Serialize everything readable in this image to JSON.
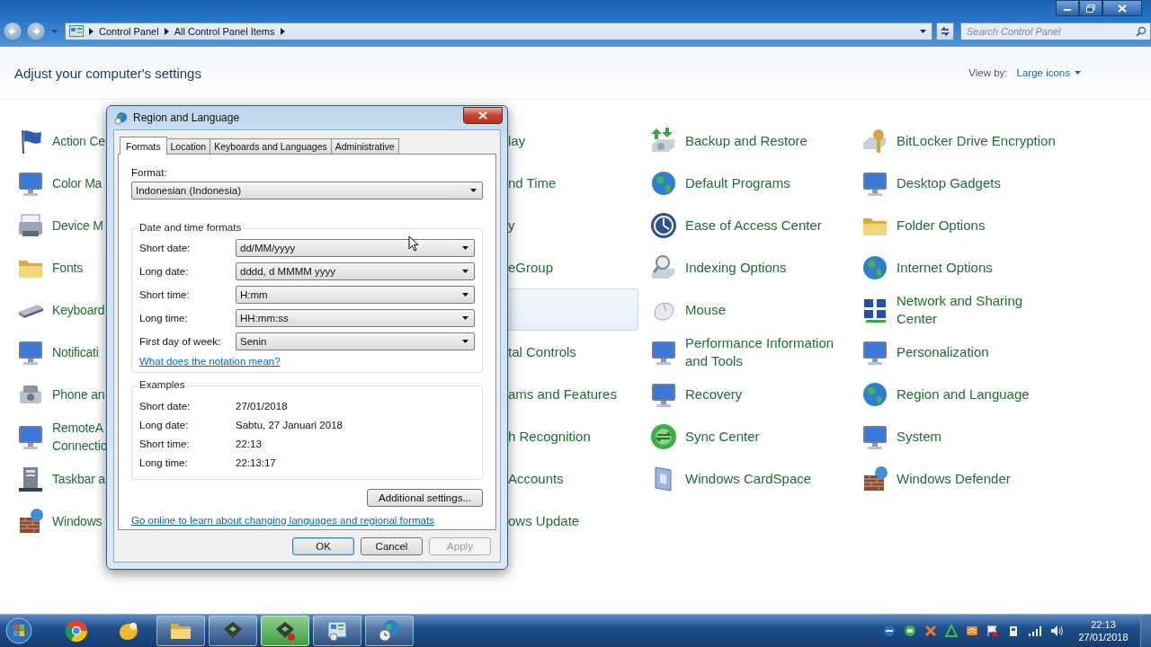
{
  "explorer": {
    "address_path": [
      "Control Panel",
      "All Control Panel Items"
    ],
    "search": {
      "placeholder": "Search Control Panel"
    }
  },
  "header": {
    "title": "Adjust your computer's settings",
    "view_by_label": "View by:",
    "view_by_value": "Large icons"
  },
  "columns": [
    [
      {
        "label": "Action Ce",
        "highlighted": false
      },
      {
        "label": "Color Ma",
        "highlighted": false
      },
      {
        "label": "Device M",
        "highlighted": false
      },
      {
        "label": "Fonts",
        "highlighted": false
      },
      {
        "label": "Keyboard",
        "highlighted": false
      },
      {
        "label": "Notificati",
        "highlighted": false
      },
      {
        "label": "Phone an",
        "highlighted": false
      },
      {
        "label": "RemoteA\nConnectio",
        "highlighted": false
      },
      {
        "label": "Taskbar a",
        "highlighted": false
      },
      {
        "label": "Windows",
        "highlighted": false
      }
    ],
    [
      {
        "label": "lay",
        "highlighted": false
      },
      {
        "label": "nd Time",
        "highlighted": false
      },
      {
        "label": "y",
        "highlighted": false
      },
      {
        "label": "eGroup",
        "highlighted": false
      },
      {
        "highlighted": true
      },
      {
        "label": "tal Controls",
        "highlighted": false
      },
      {
        "label": "ams and Features",
        "highlighted": false
      },
      {
        "label": "h Recognition",
        "highlighted": false
      },
      {
        "label": "Accounts",
        "highlighted": false
      },
      {
        "label": "ows Update",
        "highlighted": false
      }
    ],
    [
      {
        "label": "Backup and Restore",
        "highlighted": false
      },
      {
        "label": "Default Programs",
        "highlighted": false
      },
      {
        "label": "Ease of Access Center",
        "highlighted": false
      },
      {
        "label": "Indexing Options",
        "highlighted": false
      },
      {
        "label": "Mouse",
        "highlighted": false
      },
      {
        "label": "Performance Information\nand Tools",
        "highlighted": false
      },
      {
        "label": "Recovery",
        "highlighted": false
      },
      {
        "label": "Sync Center",
        "highlighted": false
      },
      {
        "label": "Windows CardSpace",
        "highlighted": false
      }
    ],
    [
      {
        "label": "BitLocker Drive Encryption",
        "highlighted": false
      },
      {
        "label": "Desktop Gadgets",
        "highlighted": false
      },
      {
        "label": "Folder Options",
        "highlighted": false
      },
      {
        "label": "Internet Options",
        "highlighted": false
      },
      {
        "label": "Network and Sharing\nCenter",
        "highlighted": false
      },
      {
        "label": "Personalization",
        "highlighted": false
      },
      {
        "label": "Region and Language",
        "highlighted": false
      },
      {
        "label": "System",
        "highlighted": false
      },
      {
        "label": "Windows Defender",
        "highlighted": false
      }
    ]
  ],
  "dialog": {
    "title": "Region and Language",
    "tabs": [
      {
        "label": "Formats",
        "selected": true
      },
      {
        "label": "Location",
        "selected": false
      },
      {
        "label": "Keyboards and Languages",
        "selected": false
      },
      {
        "label": "Administrative",
        "selected": false
      }
    ],
    "format_label": "Format:",
    "format_value": "Indonesian (Indonesia)",
    "formats_group": {
      "title": "Date and time formats",
      "rows": [
        {
          "label": "Short date:",
          "value": "dd/MM/yyyy"
        },
        {
          "label": "Long date:",
          "value": "dddd, d MMMM yyyy"
        },
        {
          "label": "Short time:",
          "value": "H:mm"
        },
        {
          "label": "Long time:",
          "value": "HH:mm:ss"
        },
        {
          "label": "First day of week:",
          "value": "Senin"
        }
      ],
      "link": "What does the notation mean?"
    },
    "examples_group": {
      "title": "Examples",
      "rows": [
        {
          "label": "Short date:",
          "value": "27/01/2018"
        },
        {
          "label": "Long date:",
          "value": "Sabtu, 27 Januari 2018"
        },
        {
          "label": "Short time:",
          "value": "22:13"
        },
        {
          "label": "Long time:",
          "value": "22:13:17"
        }
      ]
    },
    "additional_button": "Additional settings...",
    "online_link": "Go online to learn about changing languages and regional formats",
    "buttons": [
      {
        "label": "OK",
        "default": true,
        "disabled": false
      },
      {
        "label": "Cancel",
        "default": false,
        "disabled": false
      },
      {
        "label": "Apply",
        "default": false,
        "disabled": true
      }
    ]
  },
  "taskbar": {
    "apps": [
      {
        "running": false,
        "active": false
      },
      {
        "running": false,
        "active": false
      },
      {
        "running": true,
        "active": false
      },
      {
        "running": true,
        "active": false
      },
      {
        "running": true,
        "active": true
      },
      {
        "running": true,
        "active": false
      },
      {
        "running": true,
        "active": false
      }
    ],
    "clock": {
      "time": "22:13",
      "date": "27/01/2018"
    }
  }
}
